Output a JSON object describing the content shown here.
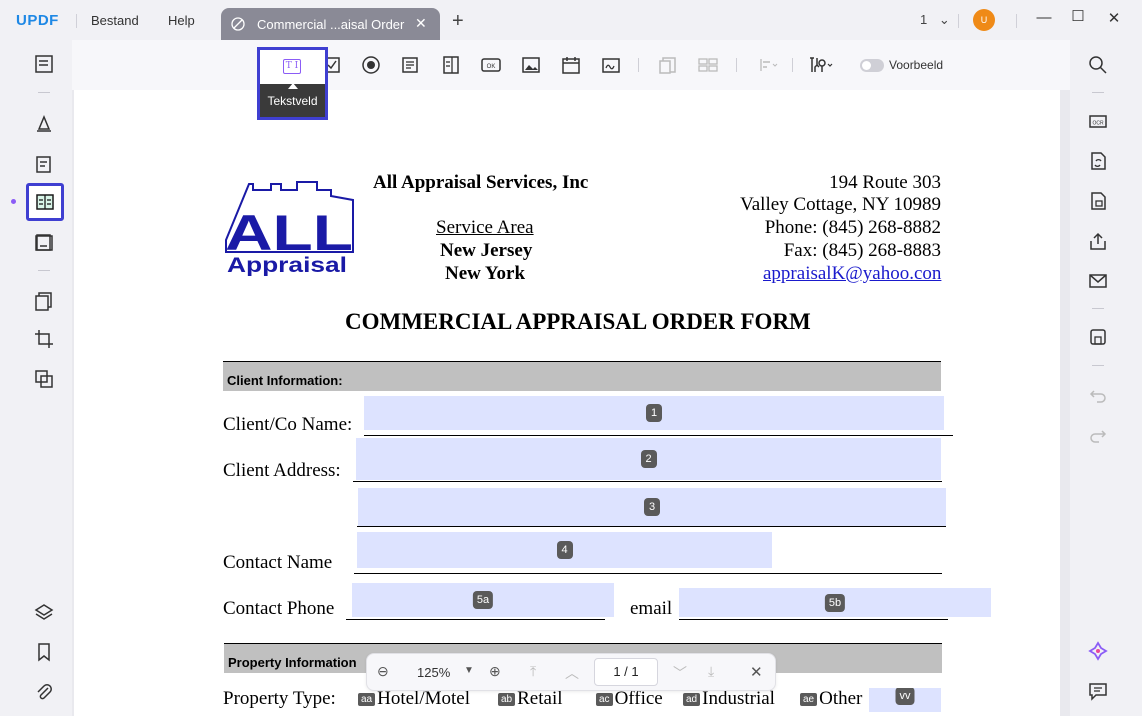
{
  "app": {
    "logo": "UPDF",
    "menu": [
      "Bestand",
      "Help"
    ],
    "tab_title": "Commercial ...aisal Order",
    "page_indicator": "1",
    "avatar_initial": "U"
  },
  "toolbar": {
    "tooltip_label": "Tekstveld",
    "tooltip_icon_text": "T I",
    "preview_label": "Voorbeeld",
    "icons": [
      "text-field-icon",
      "checkbox-icon",
      "radio-icon",
      "dropdown-icon",
      "listbox-icon",
      "button-icon",
      "image-field-icon",
      "date-field-icon",
      "signature-field-icon",
      "duplicate-icon",
      "grid-icon",
      "align-icon",
      "tools-icon"
    ]
  },
  "document": {
    "company": "All Appraisal Services, Inc",
    "service_area_label": "Service Area",
    "area1": "New Jersey",
    "area2": "New York",
    "address1": "194 Route 303",
    "address2": "Valley Cottage, NY 10989",
    "phone": "Phone:  (845) 268-8882",
    "fax": "Fax:  (845) 268-8883",
    "email": "appraisalK@yahoo.con",
    "logo_big": "ALL",
    "logo_small": "Appraisal",
    "form_title": "COMMERCIAL APPRAISAL ORDER FORM",
    "section_client": "Client Information:",
    "label_client_name": "Client/Co Name:",
    "label_client_address": "Client Address:",
    "label_contact_name": "Contact Name",
    "label_contact_phone": "Contact Phone",
    "label_email": "email",
    "section_property": "Property Information",
    "label_property_type": "Property Type:",
    "options": [
      {
        "badge": "aa",
        "label": "Hotel/Motel"
      },
      {
        "badge": "ab",
        "label": "Retail"
      },
      {
        "badge": "ac",
        "label": "Office"
      },
      {
        "badge": "ad",
        "label": "Industrial"
      },
      {
        "badge": "ae",
        "label": "Other"
      }
    ],
    "fields": [
      "1",
      "2",
      "3",
      "4",
      "5a",
      "5b",
      "vv"
    ]
  },
  "nav": {
    "zoom": "125%",
    "page": "1  /  1"
  },
  "colors": {
    "accent": "#3f3fd1",
    "field_bg": "#dde3ff",
    "avatar": "#ef8a17",
    "logo_blue": "#1a1aa6"
  }
}
